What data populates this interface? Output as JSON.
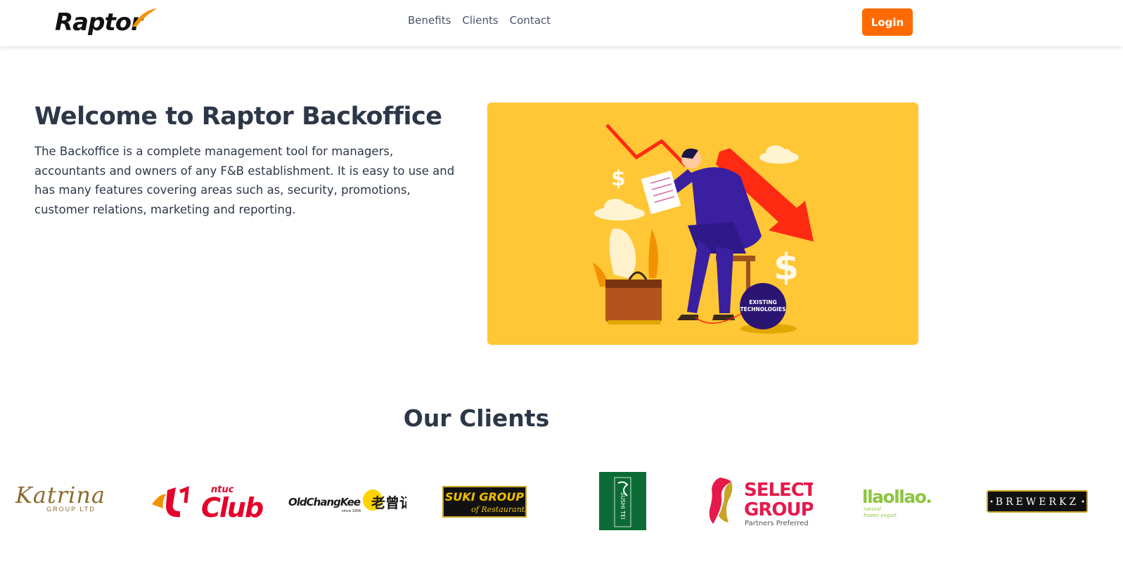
{
  "header": {
    "logo_text": "Raptor",
    "nav": [
      "Benefits",
      "Clients",
      "Contact"
    ],
    "login_label": "Login"
  },
  "hero": {
    "title": "Welcome to Raptor Backoffice",
    "description": "The Backoffice is a complete management tool for managers, accountants and owners of any F&B establishment. It is easy to use and has many features covering areas such as, security, promotions, customer relations, marketing and reporting.",
    "illustration": {
      "ball_label_1": "EXISTING",
      "ball_label_2": "TECHNOLOGIES",
      "dollar_sign": "$"
    }
  },
  "clients": {
    "title": "Our Clients",
    "logos": {
      "katrina_name": "Katrina",
      "katrina_sub": "GROUP LTD",
      "ntuc_small": "ntuc",
      "ntuc_club": "Club",
      "oldchang": "OldChangKee",
      "oldchang_cn": "老曾记",
      "oldchang_since": "since 1956",
      "suki_line1": "SUKI GROUP",
      "suki_line2": "of Restaurants",
      "sushitei": "SUSHI TEI",
      "select_line1": "SELECT",
      "select_line2": "GROUP",
      "select_tag": "Partners Preferred",
      "llaollao": "llaollao.",
      "llaollao_tag1": "natural",
      "llaollao_tag2": "frozen yogurt",
      "brewerkz": "BREWERKZ"
    }
  },
  "colors": {
    "accent": "#ff6a00",
    "hero_bg": "#ffc636",
    "text": "#2d3748"
  }
}
